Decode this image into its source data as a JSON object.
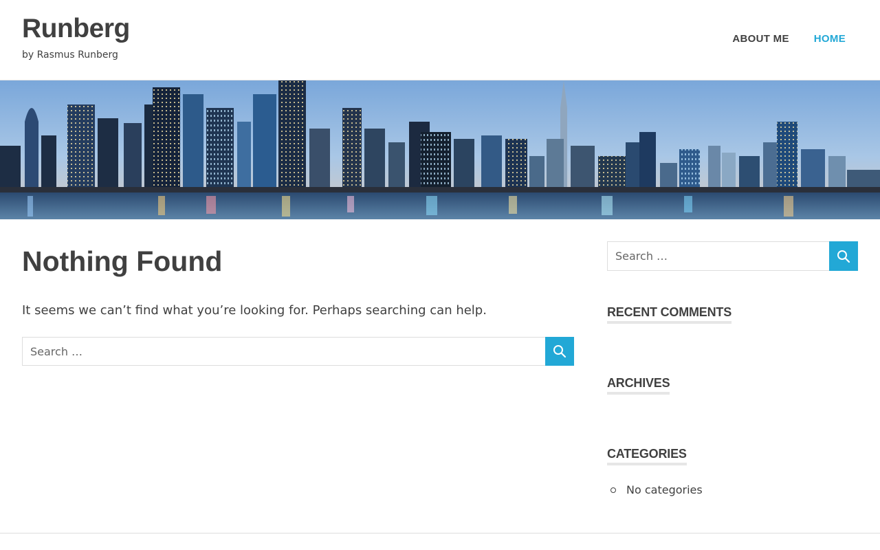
{
  "site": {
    "title": "Runberg",
    "description": "by Rasmus Runberg"
  },
  "nav": {
    "items": [
      {
        "label": "ABOUT ME",
        "active": false
      },
      {
        "label": "HOME",
        "active": true
      }
    ]
  },
  "colors": {
    "accent": "#22a8d6",
    "text": "#404040"
  },
  "main": {
    "title": "Nothing Found",
    "message": "It seems we can’t find what you’re looking for. Perhaps searching can help.",
    "search": {
      "placeholder": "Search …",
      "button_icon": "search-icon"
    }
  },
  "sidebar": {
    "search": {
      "placeholder": "Search …",
      "button_icon": "search-icon"
    },
    "widgets": {
      "recent_comments": {
        "title": "RECENT COMMENTS"
      },
      "archives": {
        "title": "ARCHIVES"
      },
      "categories": {
        "title": "CATEGORIES",
        "items": [
          "No categories"
        ]
      }
    }
  }
}
